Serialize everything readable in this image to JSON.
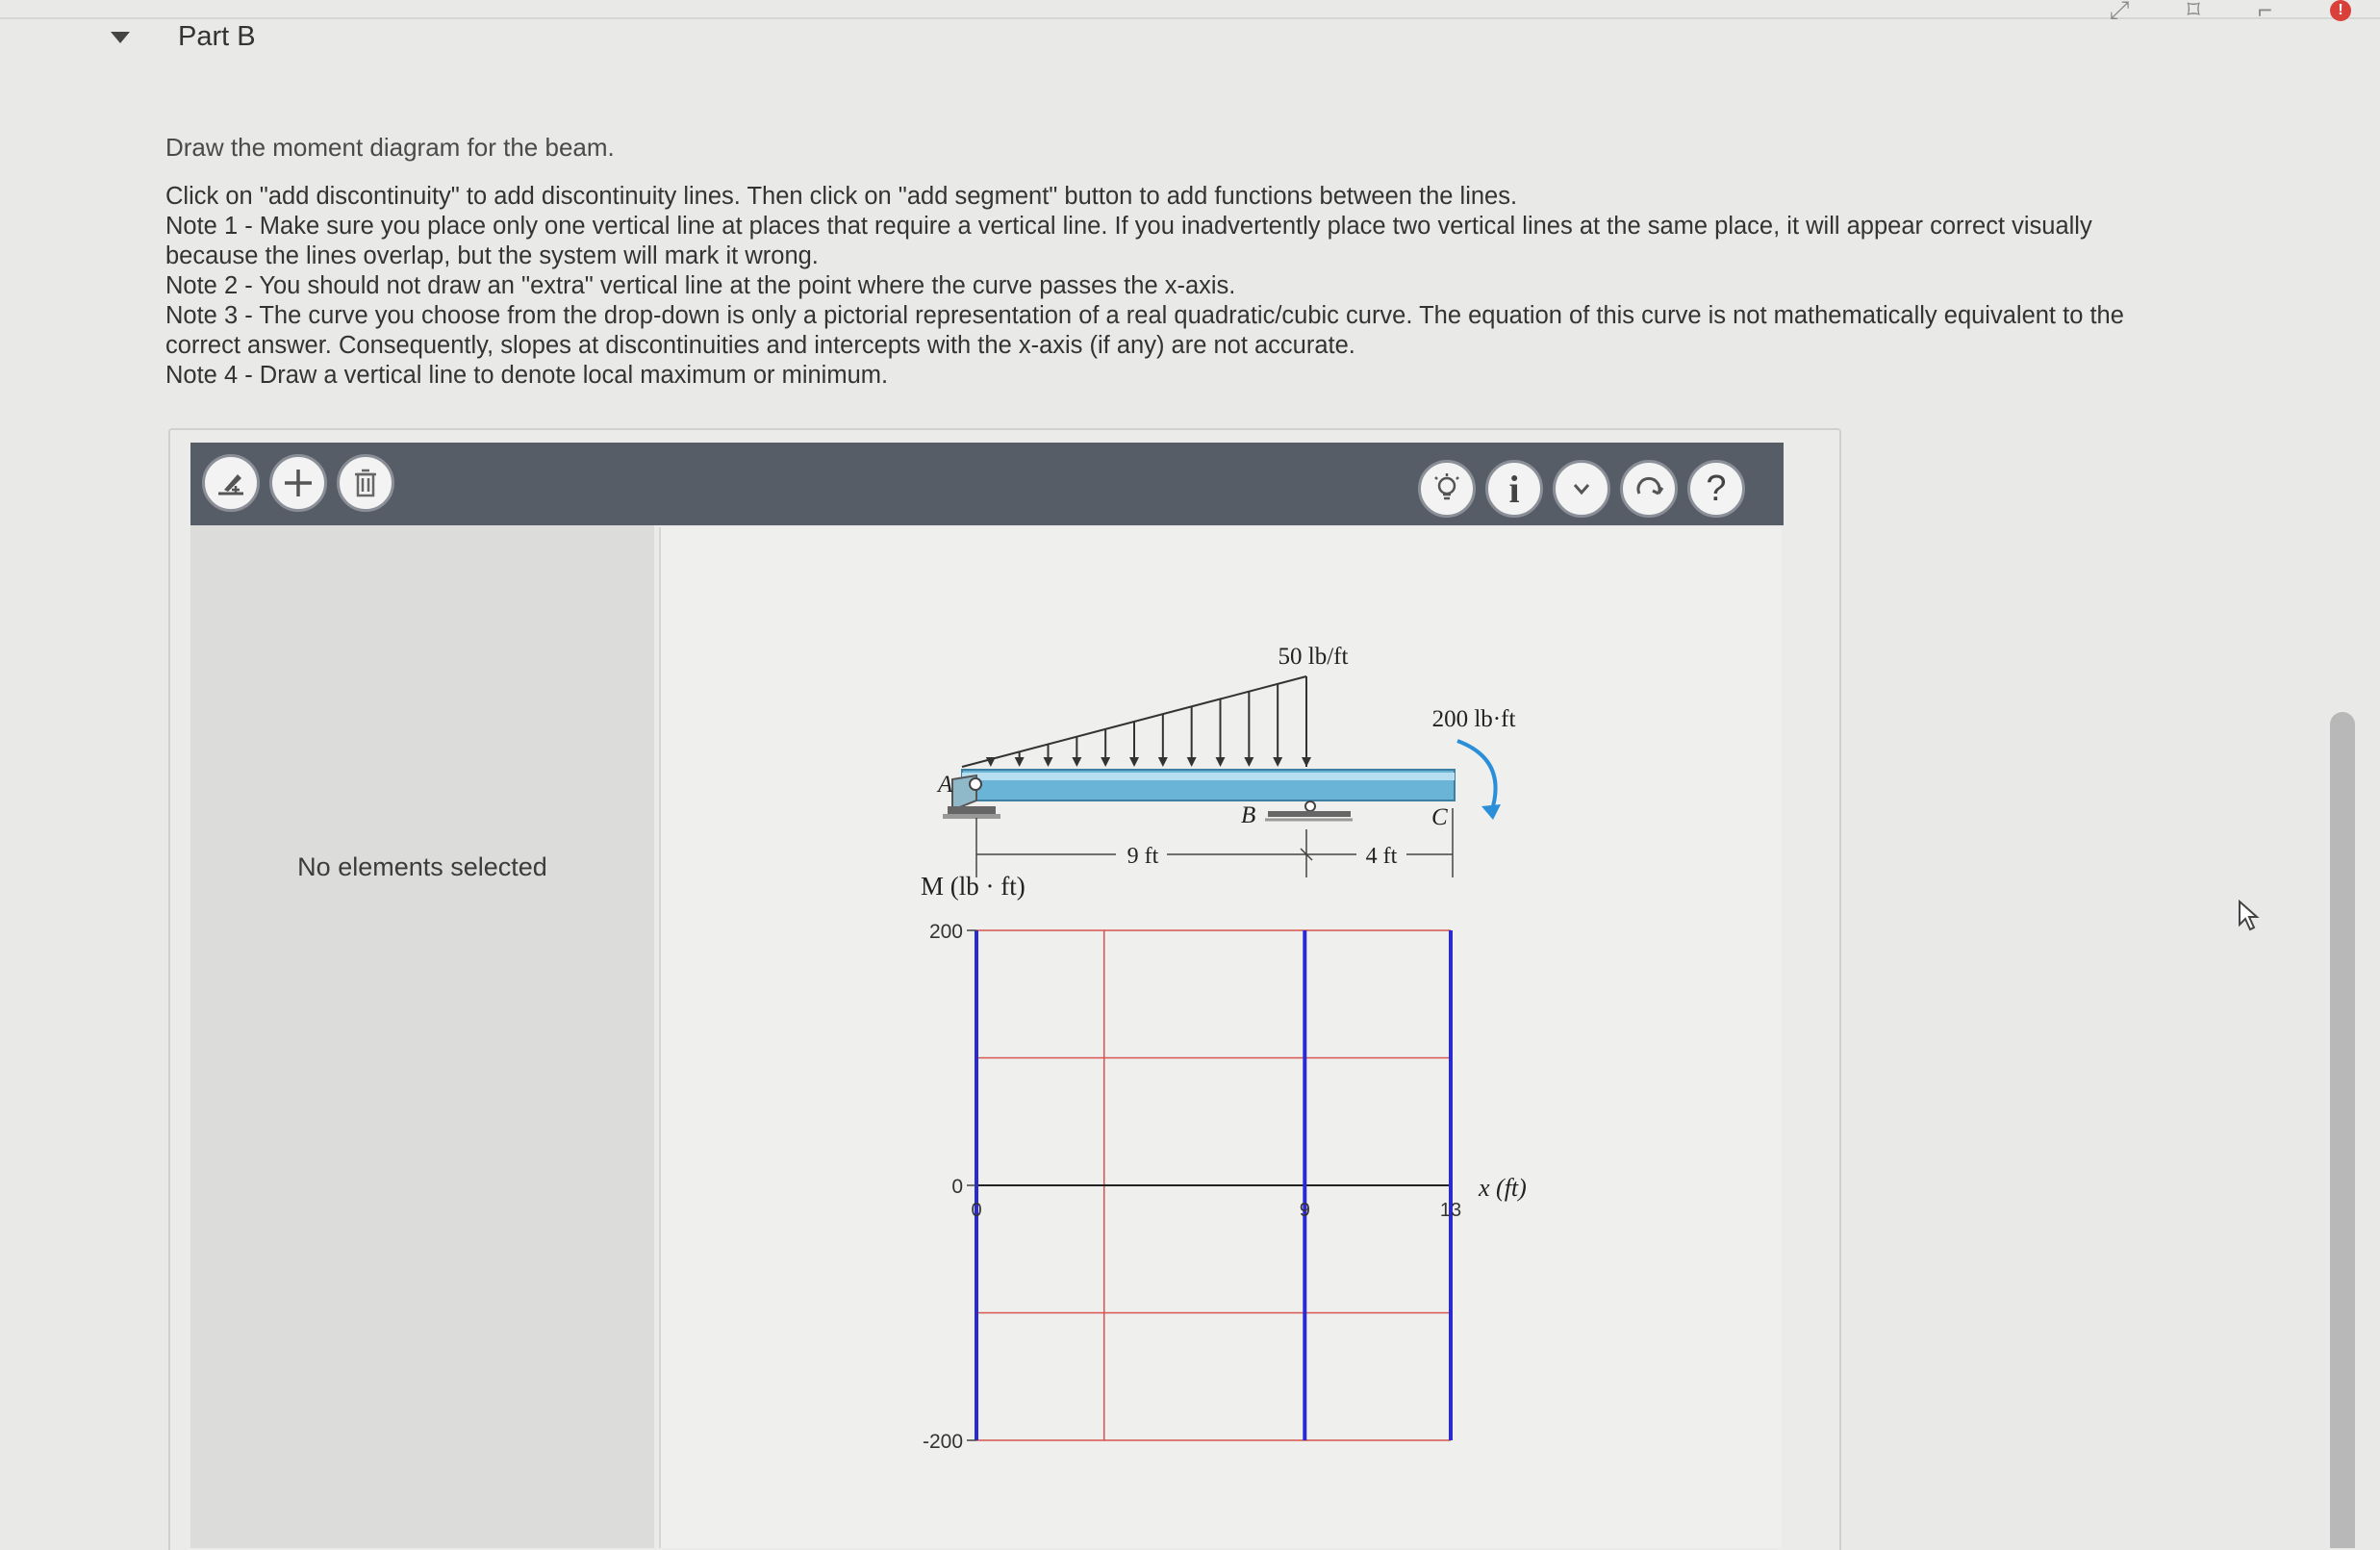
{
  "header": {
    "part_title": "Part B"
  },
  "instructions": {
    "prompt": "Draw the moment diagram for the beam.",
    "lines": [
      "Click on \"add discontinuity\" to add discontinuity lines. Then click on \"add segment\" button to add functions between the lines.",
      "Note 1 - Make sure you place only one vertical line at places that require a vertical line. If you inadvertently place two vertical lines at the same place, it will appear correct visually",
      "because the lines overlap, but the system will mark it wrong.",
      "Note 2 - You should not draw an \"extra\" vertical line at the point where the curve passes the x-axis.",
      "Note 3 - The curve you choose from the drop-down is only a pictorial representation of a real quadratic/cubic curve. The equation of this curve is not mathematically equivalent to the",
      "correct answer. Consequently, slopes at discontinuities and intercepts with the x-axis (if any) are not accurate.",
      "Note 4 - Draw a vertical line to denote local maximum or minimum."
    ]
  },
  "toolbar": {
    "left_tools": [
      "add-discontinuity-icon",
      "add-segment-icon",
      "trash-icon"
    ],
    "right_tools": [
      "hint-bulb-icon",
      "info-icon",
      "chevron-down-icon",
      "reset-icon",
      "help-icon"
    ],
    "help_glyph": "?",
    "info_glyph": "i"
  },
  "side_panel": {
    "message": "No elements selected"
  },
  "beam": {
    "load_label": "50 lb/ft",
    "moment_label": "200 lb·ft",
    "support_a": "A",
    "support_b": "B",
    "end_c": "C",
    "span_ab": "9 ft",
    "span_bc": "4 ft"
  },
  "chart_data": {
    "type": "line",
    "ylabel": "M (lb · ft)",
    "xlabel": "x (ft)",
    "ylim": [
      -200,
      200
    ],
    "yticks": [
      "200",
      "0",
      "-200"
    ],
    "xticks": [
      "0",
      "9",
      "13"
    ],
    "discontinuities_x": [
      0,
      9,
      13
    ],
    "series": [],
    "grid": true
  },
  "colors": {
    "toolbar": "#575d66",
    "grid_red": "#d9534f",
    "discontinuity_blue": "#2a2ad0",
    "beam_blue": "#6ab4d8",
    "moment_arrow": "#2a8fd8"
  }
}
